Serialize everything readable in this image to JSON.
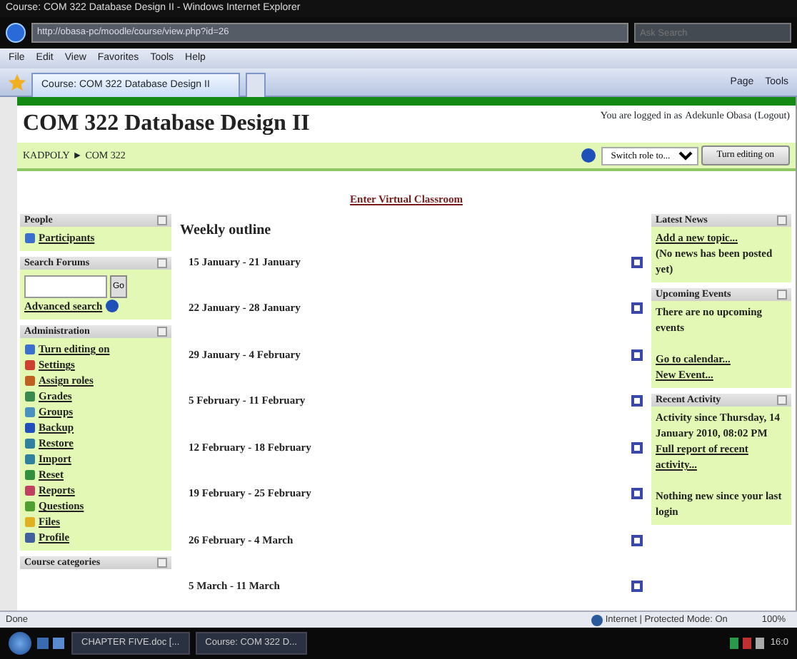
{
  "window": {
    "title": "Course: COM 322 Database Design II - Windows Internet Explorer"
  },
  "address_bar": {
    "url": "http://obasa-pc/moodle/course/view.php?id=26",
    "search_placeholder": "Ask Search"
  },
  "menu": [
    "File",
    "Edit",
    "View",
    "Favorites",
    "Tools",
    "Help"
  ],
  "tabs": [
    {
      "label": "Course: COM 322 Database Design II",
      "selected": true
    }
  ],
  "command_bar": [
    "Page",
    "Tools"
  ],
  "page": {
    "title": "COM 322 Database Design II",
    "login": {
      "prefix": "You are logged in as",
      "user": "Adekunle Obasa",
      "logout": "(Logout)"
    },
    "breadcrumb": [
      "KADPOLY",
      "COM 322"
    ],
    "breadcrumb_separator": "►",
    "switch_role": "Switch role to...",
    "edit_button": "Turn editing on",
    "virtual_classroom": "Enter Virtual Classroom",
    "left_blocks": [
      {
        "title": "People",
        "kind": "links",
        "items": [
          "Participants"
        ]
      },
      {
        "title": "Search Forums",
        "kind": "search",
        "button": "Go",
        "link": "Advanced search"
      },
      {
        "title": "Administration",
        "kind": "links",
        "items": [
          "Turn editing on",
          "Settings",
          "Assign roles",
          "Grades",
          "Groups",
          "Backup",
          "Restore",
          "Import",
          "Reset",
          "Reports",
          "Questions",
          "Files",
          "Profile"
        ]
      },
      {
        "title": "Course categories",
        "kind": "header"
      }
    ],
    "outline": {
      "title": "Weekly outline",
      "weeks": [
        "15 January - 21 January",
        "22 January - 28 January",
        "29 January - 4 February",
        "5 February - 11 February",
        "12 February - 18 February",
        "19 February - 25 February",
        "26 February - 4 March",
        "5 March - 11 March"
      ]
    },
    "right_blocks": [
      {
        "title": "Latest News",
        "lines": [
          {
            "kind": "link",
            "text": "Add a new topic..."
          },
          {
            "kind": "text",
            "text": "(No news has been posted yet)"
          }
        ]
      },
      {
        "title": "Upcoming Events",
        "lines": [
          {
            "kind": "text",
            "text": "There are no upcoming events"
          },
          {
            "kind": "gap"
          },
          {
            "kind": "link",
            "text": "Go to calendar..."
          },
          {
            "kind": "link",
            "text": "New Event..."
          }
        ]
      },
      {
        "title": "Recent Activity",
        "lines": [
          {
            "kind": "text",
            "text": "Activity since Thursday, 14 January 2010, 08:02 PM"
          },
          {
            "kind": "link",
            "text": "Full report of recent activity..."
          },
          {
            "kind": "gap"
          },
          {
            "kind": "text",
            "text": "Nothing new since your last login"
          }
        ]
      }
    ]
  },
  "status_bar": {
    "text": "Done",
    "zone": "Internet | Protected Mode: On",
    "zoom": "100%"
  },
  "taskbar": {
    "items": [
      "CHAPTER FIVE.doc [...",
      "Course: COM 322 D..."
    ],
    "clock": "16:0"
  }
}
